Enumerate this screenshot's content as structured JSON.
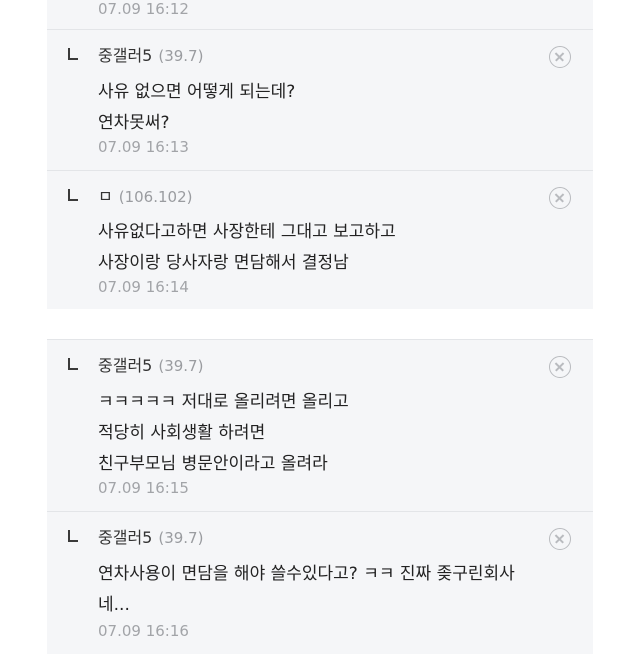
{
  "top_partial": {
    "time": "07.09 16:12"
  },
  "comments": [
    {
      "nick": "중갤러5",
      "ip": "(39.7)",
      "lines": [
        "사유 없으면 어떻게 되는데?",
        "연차못써?"
      ],
      "time": "07.09 16:13"
    },
    {
      "nick": "ㅁ",
      "ip": "(106.102)",
      "lines": [
        "사유없다고하면 사장한테 그대고 보고하고",
        "사장이랑 당사자랑 면담해서 결정남"
      ],
      "time": "07.09 16:14"
    },
    {
      "nick": "중갤러5",
      "ip": "(39.7)",
      "lines": [
        "ㅋㅋㅋㅋㅋ 저대로 올리려면 올리고",
        "적당히 사회생활 하려면",
        "친구부모님 병문안이라고 올려라"
      ],
      "time": "07.09 16:15"
    },
    {
      "nick": "중갤러5",
      "ip": "(39.7)",
      "lines": [
        "연차사용이 면담을 해야 쓸수있다고? ㅋㅋ 진짜 좆구린회사",
        "네..."
      ],
      "time": "07.09 16:16"
    }
  ]
}
